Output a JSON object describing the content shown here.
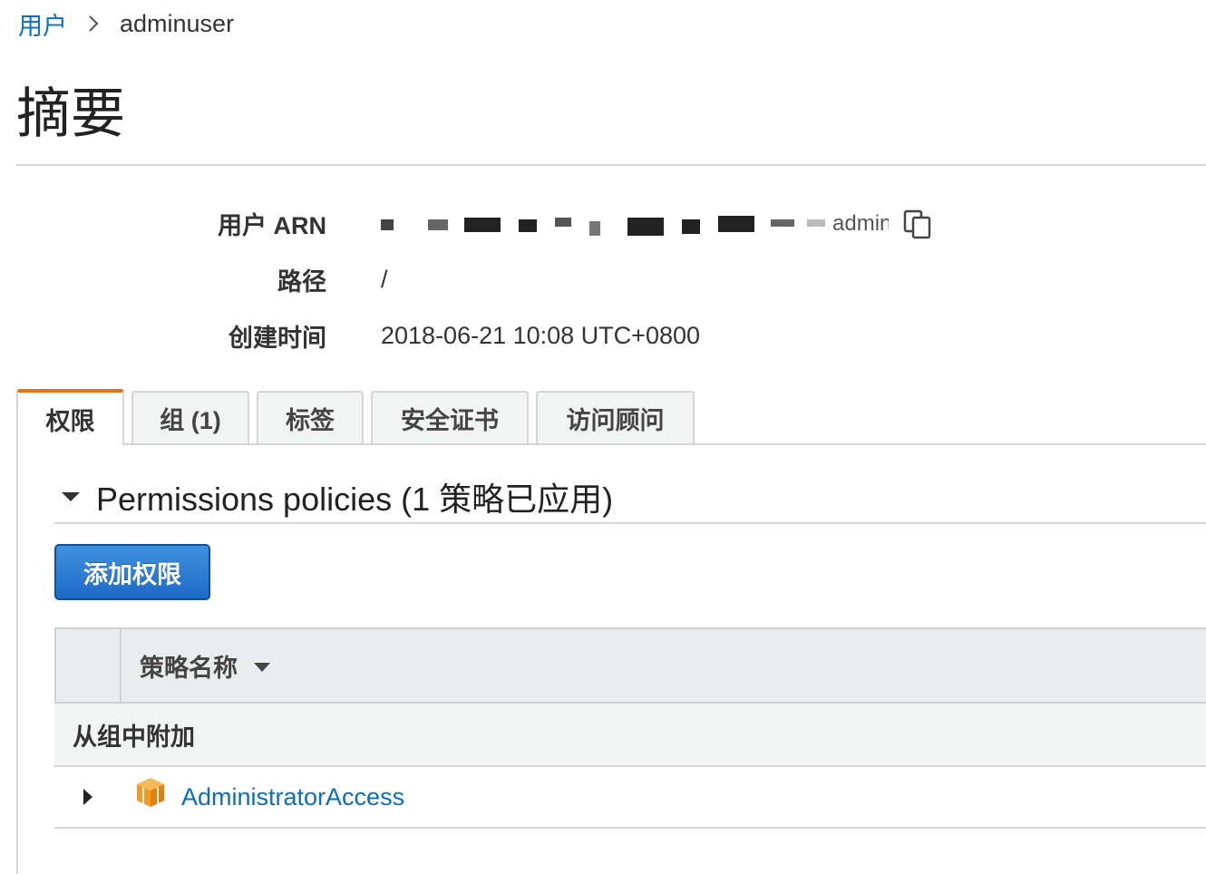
{
  "breadcrumb": {
    "parent": "用户",
    "current": "adminuser"
  },
  "page_title": "摘要",
  "summary": {
    "arn_label": "用户 ARN",
    "arn_value_visible": "...adminuser",
    "path_label": "路径",
    "path_value": "/",
    "created_label": "创建时间",
    "created_value": "2018-06-21 10:08 UTC+0800"
  },
  "tabs": [
    {
      "label": "权限",
      "active": true
    },
    {
      "label": "组 (1)",
      "active": false
    },
    {
      "label": "标签",
      "active": false
    },
    {
      "label": "安全证书",
      "active": false
    },
    {
      "label": "访问顾问",
      "active": false
    }
  ],
  "permissions": {
    "section_title": "Permissions policies (1 策略已应用)",
    "add_button": "添加权限",
    "column_policy_name": "策略名称",
    "group_row_label": "从组中附加",
    "policies": [
      {
        "name": "AdministratorAccess",
        "icon": "aws-managed-policy-box-icon"
      }
    ]
  },
  "colors": {
    "link": "#0a6ebd",
    "active_tab_accent": "#ec7211",
    "primary_button": "#1d6ac6",
    "policy_icon": "#f29b24"
  }
}
